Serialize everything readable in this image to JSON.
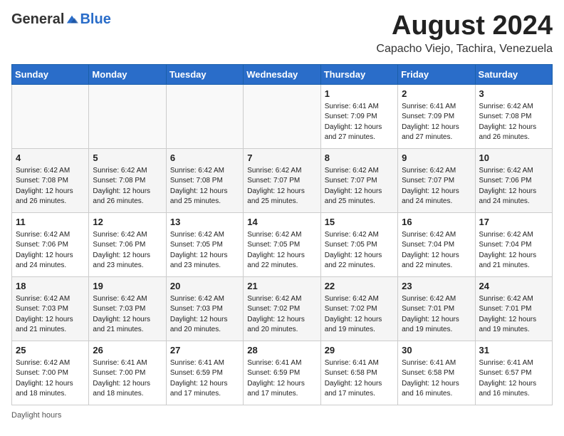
{
  "header": {
    "logo_general": "General",
    "logo_blue": "Blue",
    "month_title": "August 2024",
    "location": "Capacho Viejo, Tachira, Venezuela"
  },
  "days_of_week": [
    "Sunday",
    "Monday",
    "Tuesday",
    "Wednesday",
    "Thursday",
    "Friday",
    "Saturday"
  ],
  "weeks": [
    [
      {
        "day": "",
        "info": ""
      },
      {
        "day": "",
        "info": ""
      },
      {
        "day": "",
        "info": ""
      },
      {
        "day": "",
        "info": ""
      },
      {
        "day": "1",
        "info": "Sunrise: 6:41 AM\nSunset: 7:09 PM\nDaylight: 12 hours\nand 27 minutes."
      },
      {
        "day": "2",
        "info": "Sunrise: 6:41 AM\nSunset: 7:09 PM\nDaylight: 12 hours\nand 27 minutes."
      },
      {
        "day": "3",
        "info": "Sunrise: 6:42 AM\nSunset: 7:08 PM\nDaylight: 12 hours\nand 26 minutes."
      }
    ],
    [
      {
        "day": "4",
        "info": "Sunrise: 6:42 AM\nSunset: 7:08 PM\nDaylight: 12 hours\nand 26 minutes."
      },
      {
        "day": "5",
        "info": "Sunrise: 6:42 AM\nSunset: 7:08 PM\nDaylight: 12 hours\nand 26 minutes."
      },
      {
        "day": "6",
        "info": "Sunrise: 6:42 AM\nSunset: 7:08 PM\nDaylight: 12 hours\nand 25 minutes."
      },
      {
        "day": "7",
        "info": "Sunrise: 6:42 AM\nSunset: 7:07 PM\nDaylight: 12 hours\nand 25 minutes."
      },
      {
        "day": "8",
        "info": "Sunrise: 6:42 AM\nSunset: 7:07 PM\nDaylight: 12 hours\nand 25 minutes."
      },
      {
        "day": "9",
        "info": "Sunrise: 6:42 AM\nSunset: 7:07 PM\nDaylight: 12 hours\nand 24 minutes."
      },
      {
        "day": "10",
        "info": "Sunrise: 6:42 AM\nSunset: 7:06 PM\nDaylight: 12 hours\nand 24 minutes."
      }
    ],
    [
      {
        "day": "11",
        "info": "Sunrise: 6:42 AM\nSunset: 7:06 PM\nDaylight: 12 hours\nand 24 minutes."
      },
      {
        "day": "12",
        "info": "Sunrise: 6:42 AM\nSunset: 7:06 PM\nDaylight: 12 hours\nand 23 minutes."
      },
      {
        "day": "13",
        "info": "Sunrise: 6:42 AM\nSunset: 7:05 PM\nDaylight: 12 hours\nand 23 minutes."
      },
      {
        "day": "14",
        "info": "Sunrise: 6:42 AM\nSunset: 7:05 PM\nDaylight: 12 hours\nand 22 minutes."
      },
      {
        "day": "15",
        "info": "Sunrise: 6:42 AM\nSunset: 7:05 PM\nDaylight: 12 hours\nand 22 minutes."
      },
      {
        "day": "16",
        "info": "Sunrise: 6:42 AM\nSunset: 7:04 PM\nDaylight: 12 hours\nand 22 minutes."
      },
      {
        "day": "17",
        "info": "Sunrise: 6:42 AM\nSunset: 7:04 PM\nDaylight: 12 hours\nand 21 minutes."
      }
    ],
    [
      {
        "day": "18",
        "info": "Sunrise: 6:42 AM\nSunset: 7:03 PM\nDaylight: 12 hours\nand 21 minutes."
      },
      {
        "day": "19",
        "info": "Sunrise: 6:42 AM\nSunset: 7:03 PM\nDaylight: 12 hours\nand 21 minutes."
      },
      {
        "day": "20",
        "info": "Sunrise: 6:42 AM\nSunset: 7:03 PM\nDaylight: 12 hours\nand 20 minutes."
      },
      {
        "day": "21",
        "info": "Sunrise: 6:42 AM\nSunset: 7:02 PM\nDaylight: 12 hours\nand 20 minutes."
      },
      {
        "day": "22",
        "info": "Sunrise: 6:42 AM\nSunset: 7:02 PM\nDaylight: 12 hours\nand 19 minutes."
      },
      {
        "day": "23",
        "info": "Sunrise: 6:42 AM\nSunset: 7:01 PM\nDaylight: 12 hours\nand 19 minutes."
      },
      {
        "day": "24",
        "info": "Sunrise: 6:42 AM\nSunset: 7:01 PM\nDaylight: 12 hours\nand 19 minutes."
      }
    ],
    [
      {
        "day": "25",
        "info": "Sunrise: 6:42 AM\nSunset: 7:00 PM\nDaylight: 12 hours\nand 18 minutes."
      },
      {
        "day": "26",
        "info": "Sunrise: 6:41 AM\nSunset: 7:00 PM\nDaylight: 12 hours\nand 18 minutes."
      },
      {
        "day": "27",
        "info": "Sunrise: 6:41 AM\nSunset: 6:59 PM\nDaylight: 12 hours\nand 17 minutes."
      },
      {
        "day": "28",
        "info": "Sunrise: 6:41 AM\nSunset: 6:59 PM\nDaylight: 12 hours\nand 17 minutes."
      },
      {
        "day": "29",
        "info": "Sunrise: 6:41 AM\nSunset: 6:58 PM\nDaylight: 12 hours\nand 17 minutes."
      },
      {
        "day": "30",
        "info": "Sunrise: 6:41 AM\nSunset: 6:58 PM\nDaylight: 12 hours\nand 16 minutes."
      },
      {
        "day": "31",
        "info": "Sunrise: 6:41 AM\nSunset: 6:57 PM\nDaylight: 12 hours\nand 16 minutes."
      }
    ]
  ],
  "footer": {
    "note": "Daylight hours"
  }
}
